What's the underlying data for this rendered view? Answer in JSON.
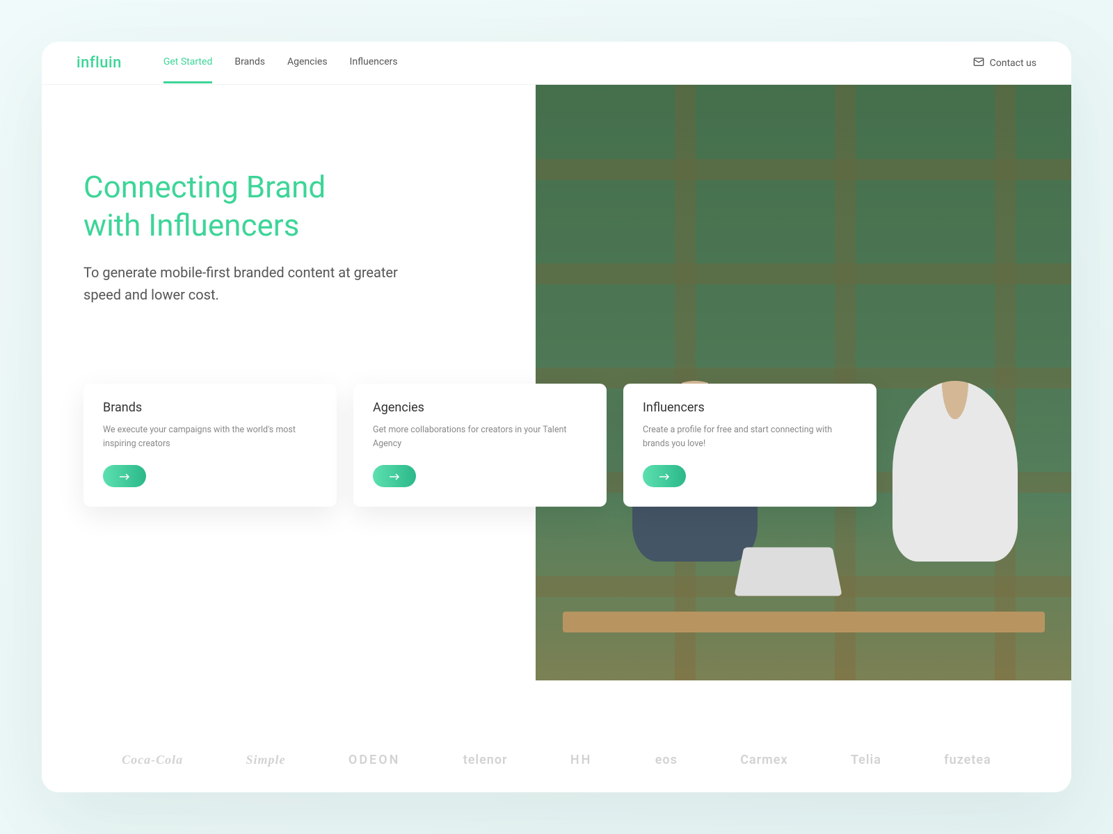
{
  "brand": {
    "name": "influin"
  },
  "nav": {
    "items": [
      {
        "label": "Get Started",
        "active": true
      },
      {
        "label": "Brands",
        "active": false
      },
      {
        "label": "Agencies",
        "active": false
      },
      {
        "label": "Influencers",
        "active": false
      }
    ],
    "contact_label": "Contact us"
  },
  "hero": {
    "title_line1": "Connecting Brand",
    "title_line2": "with Influencers",
    "subtitle": "To generate mobile-first branded content at greater speed and lower cost."
  },
  "cards": [
    {
      "title": "Brands",
      "desc": "We execute your campaigns with the world's most inspiring creators"
    },
    {
      "title": "Agencies",
      "desc": "Get more collaborations for creators in your Talent Agency"
    },
    {
      "title": "Influencers",
      "desc": "Create a profile for free and start connecting with brands you love!"
    }
  ],
  "logos": [
    "Coca-Cola",
    "Simple",
    "ODEON",
    "telenor",
    "HH",
    "eos",
    "Carmex",
    "Telia",
    "fuzetea"
  ],
  "colors": {
    "accent": "#3dd598"
  }
}
